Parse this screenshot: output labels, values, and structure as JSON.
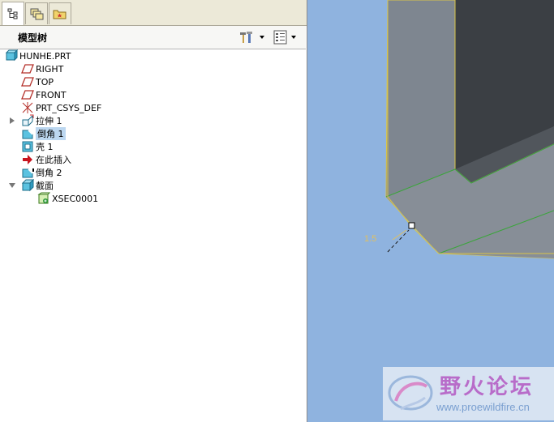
{
  "navigator": {
    "tabs": [
      {
        "id": "model-tree",
        "icon": "model-tree-icon",
        "active": true
      },
      {
        "id": "layers",
        "icon": "layers-icon",
        "active": false
      },
      {
        "id": "folder-browser",
        "icon": "folder-icon",
        "active": false
      }
    ],
    "panel_title": "模型树",
    "tools": [
      {
        "icon": "settings-tools-icon"
      },
      {
        "icon": "show-list-icon"
      }
    ]
  },
  "tree": {
    "items": [
      {
        "label": "HUNHE.PRT",
        "icon": "part-icon"
      },
      {
        "label": "RIGHT",
        "icon": "datum-plane-icon"
      },
      {
        "label": "TOP",
        "icon": "datum-plane-icon"
      },
      {
        "label": "FRONT",
        "icon": "datum-plane-icon"
      },
      {
        "label": "PRT_CSYS_DEF",
        "icon": "coordinate-system-icon"
      },
      {
        "label": "拉伸 1",
        "icon": "extrude-icon",
        "expandable": true
      },
      {
        "label": "倒角 1",
        "icon": "chamfer-icon",
        "selected": true
      },
      {
        "label": "壳 1",
        "icon": "shell-icon"
      },
      {
        "label": "在此插入",
        "icon": "insert-here-arrow-icon"
      },
      {
        "label": "倒角 2",
        "icon": "chamfer-icon"
      },
      {
        "label": "截面",
        "icon": "section-icon",
        "expanded": true
      },
      {
        "label": "XSEC0001",
        "icon": "xsec-icon"
      }
    ]
  },
  "viewport": {
    "dimension_label": "1.5",
    "background": "#8fb3df"
  },
  "watermark": {
    "title": "野火论坛",
    "url": "www.proewildfire.cn"
  }
}
